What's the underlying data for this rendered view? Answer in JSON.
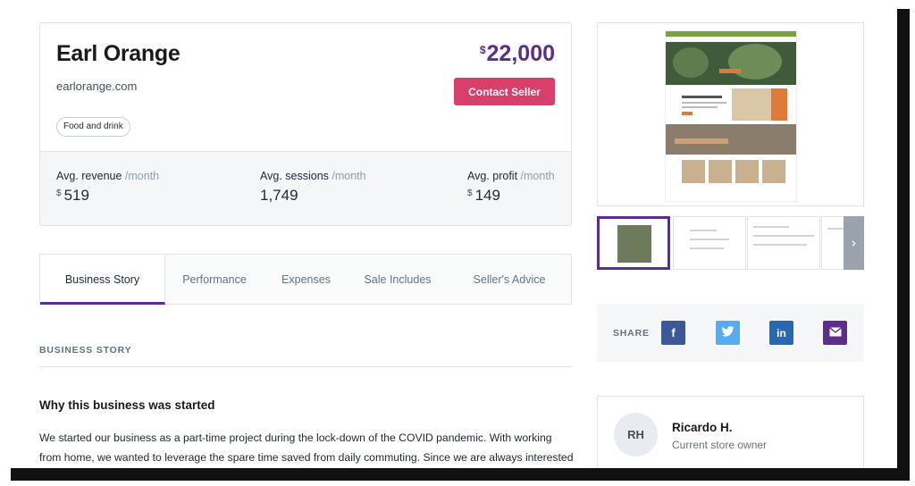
{
  "listing": {
    "title": "Earl Orange",
    "domain": "earlorange.com",
    "tag": "Food and drink",
    "price_currency": "$",
    "price": "22,000",
    "contact_label": "Contact Seller"
  },
  "stats": [
    {
      "label": "Avg. revenue",
      "period": "/month",
      "currency": "$",
      "value": "519"
    },
    {
      "label": "Avg. sessions",
      "period": "/month",
      "currency": "",
      "value": "1,749"
    },
    {
      "label": "Avg. profit",
      "period": "/month",
      "currency": "$",
      "value": "149"
    }
  ],
  "tabs": [
    "Business Story",
    "Performance",
    "Expenses",
    "Sale Includes",
    "Seller's Advice"
  ],
  "active_tab": "Business Story",
  "section": {
    "heading": "BUSINESS STORY",
    "subheading": "Why this business was started",
    "body": "We started our business as a part-time project during the lock-down of the COVID pandemic. With working from home, we wanted to leverage the spare time saved from daily commuting. Since we are always interested"
  },
  "share": {
    "label": "SHARE",
    "icons": [
      "facebook-icon",
      "twitter-icon",
      "linkedin-icon",
      "email-icon"
    ],
    "facebook_glyph": "f",
    "linkedin_glyph": "in"
  },
  "owner": {
    "initials": "RH",
    "name": "Ricardo H.",
    "role": "Current store owner"
  },
  "gallery": {
    "next_glyph": "›"
  },
  "colors": {
    "accent": "#5c2d8a",
    "contact_button": "#d83f6b",
    "facebook": "#3b5998",
    "twitter": "#55acee",
    "linkedin": "#2867b2",
    "email": "#5c2d8a"
  }
}
